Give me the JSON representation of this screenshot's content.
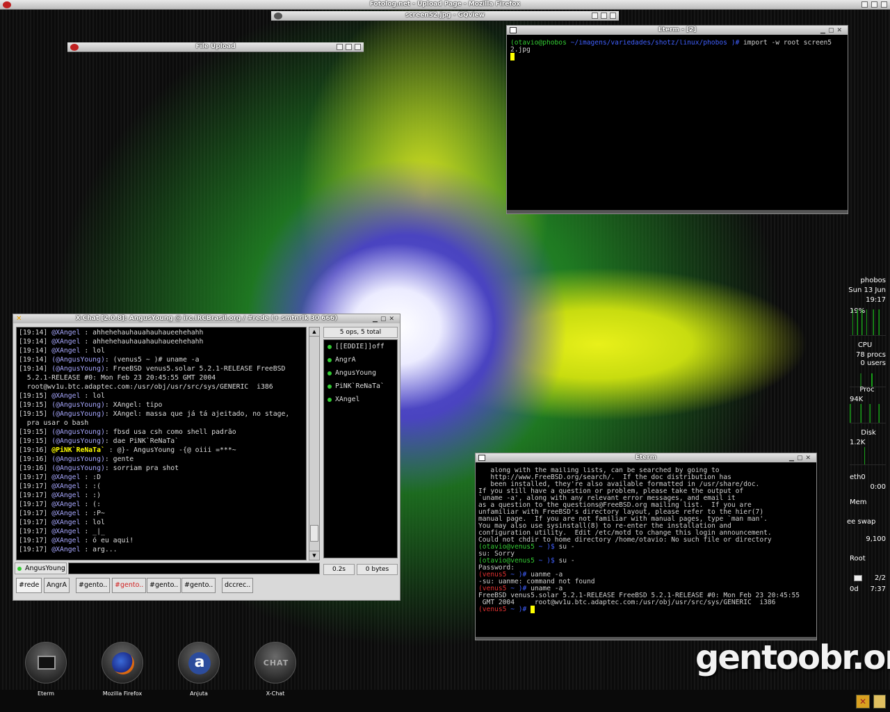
{
  "topbar": {
    "title": "Fotolog.net - Upload Page - Mozilla Firefox"
  },
  "gqview": {
    "title": "screen52.jpg - GQview"
  },
  "file_upload": {
    "title": "File Upload"
  },
  "eterm2": {
    "title": "Eterm - [2]",
    "lines": [
      [
        {
          "t": "(otavio@phobos ",
          "c": "g"
        },
        {
          "t": "~/imagens/variedades/shotz/linux/phobos ",
          "c": "b"
        },
        {
          "t": ")# ",
          "c": "b"
        },
        {
          "t": "import -w root screen5",
          "c": ""
        }
      ],
      [
        {
          "t": "2.jpg",
          "c": ""
        }
      ]
    ]
  },
  "eterm": {
    "title": "Eterm",
    "lines": [
      [
        {
          "t": "   along with the mailing lists, can be searched by going to",
          "c": ""
        }
      ],
      [
        {
          "t": "   http://www.FreeBSD.org/search/.  If the doc distribution has",
          "c": ""
        }
      ],
      [
        {
          "t": "   been installed, they're also available formatted in /usr/share/doc.",
          "c": ""
        }
      ],
      [
        {
          "t": "",
          "c": ""
        }
      ],
      [
        {
          "t": "If you still have a question or problem, please take the output of",
          "c": ""
        }
      ],
      [
        {
          "t": "`uname -a', along with any relevant error messages, and email it",
          "c": ""
        }
      ],
      [
        {
          "t": "as a question to the questions@FreeBSD.org mailing list.  If you are",
          "c": ""
        }
      ],
      [
        {
          "t": "unfamiliar with FreeBSD's directory layout, please refer to the hier(7)",
          "c": ""
        }
      ],
      [
        {
          "t": "manual page.  If you are not familiar with manual pages, type `man man'.",
          "c": ""
        }
      ],
      [
        {
          "t": "",
          "c": ""
        }
      ],
      [
        {
          "t": "You may also use sysinstall(8) to re-enter the installation and",
          "c": ""
        }
      ],
      [
        {
          "t": "configuration utility.  Edit /etc/motd to change this login announcement.",
          "c": ""
        }
      ],
      [
        {
          "t": "",
          "c": ""
        }
      ],
      [
        {
          "t": "Could not chdir to home directory /home/otavio: No such file or directory",
          "c": ""
        }
      ],
      [
        {
          "t": "(otavio@venus5 ",
          "c": "g"
        },
        {
          "t": "~ )$ ",
          "c": "b"
        },
        {
          "t": "su -",
          "c": ""
        }
      ],
      [
        {
          "t": "su: Sorry",
          "c": ""
        }
      ],
      [
        {
          "t": "(otavio@venus5 ",
          "c": "g"
        },
        {
          "t": "~ )$ ",
          "c": "b"
        },
        {
          "t": "su -",
          "c": ""
        }
      ],
      [
        {
          "t": "Password:",
          "c": ""
        }
      ],
      [
        {
          "t": "(venus5 ",
          "c": "r"
        },
        {
          "t": "~ )# ",
          "c": "b"
        },
        {
          "t": "uanme -a",
          "c": ""
        }
      ],
      [
        {
          "t": "-su: uanme: command not found",
          "c": ""
        }
      ],
      [
        {
          "t": "(venus5 ",
          "c": "r"
        },
        {
          "t": "~ )# ",
          "c": "b"
        },
        {
          "t": "uname -a",
          "c": ""
        }
      ],
      [
        {
          "t": "FreeBSD venus5.solar 5.2.1-RELEASE FreeBSD 5.2.1-RELEASE #0: Mon Feb 23 20:45:55",
          "c": ""
        }
      ],
      [
        {
          "t": " GMT 2004     root@wv1u.btc.adaptec.com:/usr/obj/usr/src/sys/GENERIC  i386",
          "c": ""
        }
      ],
      [
        {
          "t": "(venus5 ",
          "c": "r"
        },
        {
          "t": "~ )# ",
          "c": "b"
        }
      ]
    ]
  },
  "xchat": {
    "title": "X-Chat [2.0.8]: AngusYoung @ irc.IRCBrasil.org / #rede (+ smtnrlk 30 666)",
    "ops_label": "5 ops, 5 total",
    "lines": [
      [
        {
          "t": "[19:14] "
        },
        {
          "t": "@XAngel",
          "c": "nick"
        },
        {
          "t": " : ahhehehauhauahauhaueehehahh"
        }
      ],
      [
        {
          "t": "[19:14] "
        },
        {
          "t": "@XAngel",
          "c": "nick"
        },
        {
          "t": " : ahhehehauhauahauhaueehehahh"
        }
      ],
      [
        {
          "t": "[19:14] "
        },
        {
          "t": "@XAngel",
          "c": "nick"
        },
        {
          "t": " : lol"
        }
      ],
      [
        {
          "t": "[19:14] "
        },
        {
          "t": "(@AngusYoung)",
          "c": "nick"
        },
        {
          "t": ": (venus5 ~ )# uname -a"
        }
      ],
      [
        {
          "t": "[19:14] "
        },
        {
          "t": "(@AngusYoung)",
          "c": "nick"
        },
        {
          "t": ": FreeBSD venus5.solar 5.2.1-RELEASE FreeBSD"
        }
      ],
      [
        {
          "t": "  5.2.1-RELEASE #0: Mon Feb 23 20:45:55 GMT 2004"
        }
      ],
      [
        {
          "t": "  root@wv1u.btc.adaptec.com:/usr/obj/usr/src/sys/GENERIC  i386"
        }
      ],
      [
        {
          "t": "[19:15] "
        },
        {
          "t": "@XAngel",
          "c": "nick"
        },
        {
          "t": " : lol"
        }
      ],
      [
        {
          "t": "[19:15] "
        },
        {
          "t": "(@AngusYoung)",
          "c": "nick"
        },
        {
          "t": ": XAngel: tipo"
        }
      ],
      [
        {
          "t": "[19:15] "
        },
        {
          "t": "(@AngusYoung)",
          "c": "nick"
        },
        {
          "t": ": XAngel: massa que já tá ajeitado, no stage,"
        }
      ],
      [
        {
          "t": "  pra usar o bash"
        }
      ],
      [
        {
          "t": "[19:15] "
        },
        {
          "t": "(@AngusYoung)",
          "c": "nick"
        },
        {
          "t": ": fbsd usa csh como shell padrão"
        }
      ],
      [
        {
          "t": "[19:15] "
        },
        {
          "t": "(@AngusYoung)",
          "c": "nick"
        },
        {
          "t": ": dae PiNK`ReNaTa`"
        }
      ],
      [
        {
          "t": "[19:16] "
        },
        {
          "t": "@PiNK`ReNaTa`",
          "c": "pink"
        },
        {
          "t": " : @}- AngusYoung -{@ oiii =***~"
        }
      ],
      [
        {
          "t": "[19:16] "
        },
        {
          "t": "(@AngusYoung)",
          "c": "nick"
        },
        {
          "t": ": gente"
        }
      ],
      [
        {
          "t": "[19:16] "
        },
        {
          "t": "(@AngusYoung)",
          "c": "nick"
        },
        {
          "t": ": sorriam pra shot"
        }
      ],
      [
        {
          "t": "[19:17] "
        },
        {
          "t": "@XAngel",
          "c": "nick"
        },
        {
          "t": " : :D"
        }
      ],
      [
        {
          "t": "[19:17] "
        },
        {
          "t": "@XAngel",
          "c": "nick"
        },
        {
          "t": " : :("
        }
      ],
      [
        {
          "t": "[19:17] "
        },
        {
          "t": "@XAngel",
          "c": "nick"
        },
        {
          "t": " : :)"
        }
      ],
      [
        {
          "t": "[19:17] "
        },
        {
          "t": "@XAngel",
          "c": "nick"
        },
        {
          "t": " : (:"
        }
      ],
      [
        {
          "t": "[19:17] "
        },
        {
          "t": "@XAngel",
          "c": "nick"
        },
        {
          "t": " : :P~"
        }
      ],
      [
        {
          "t": "[19:17] "
        },
        {
          "t": "@XAngel",
          "c": "nick"
        },
        {
          "t": " : lol"
        }
      ],
      [
        {
          "t": "[19:17] "
        },
        {
          "t": "@XAngel",
          "c": "nick"
        },
        {
          "t": " : _|_"
        }
      ],
      [
        {
          "t": "[19:17] "
        },
        {
          "t": "@XAngel",
          "c": "nick"
        },
        {
          "t": " : ó eu aqui!"
        }
      ],
      [
        {
          "t": "[19:17] "
        },
        {
          "t": "@XAngel",
          "c": "nick"
        },
        {
          "t": " : arg..."
        }
      ]
    ],
    "users": [
      "[[EDDIE]]off",
      "AngrA",
      "AngusYoung",
      "PiNK`ReNaTa`",
      "XAngel"
    ],
    "nick": "AngusYoung",
    "lag": "0.2s",
    "throughput": "0 bytes",
    "tabs": [
      {
        "label": "#rede",
        "highlight": false
      },
      {
        "label": "AngrA",
        "highlight": false
      },
      {
        "label": "#gento..",
        "highlight": false
      },
      {
        "label": "#gento..",
        "highlight": true
      },
      {
        "label": "#gento..",
        "highlight": false
      },
      {
        "label": "#gento..",
        "highlight": false
      },
      {
        "label": "dccrec..",
        "highlight": false
      }
    ]
  },
  "dock": {
    "items": [
      {
        "label": "Eterm",
        "icon": "terminal-icon"
      },
      {
        "label": "Mozilla Firefox",
        "icon": "firefox-icon"
      },
      {
        "label": "Anjuta",
        "icon": "anjuta-icon"
      },
      {
        "label": "X-Chat",
        "icon": "chat-icon",
        "glyph": "CHAT"
      }
    ]
  },
  "gkrellm": {
    "host": "phobos",
    "date": "Sun 13 Jun",
    "time": "19:17",
    "cpu_pct": "19%",
    "cpu_label": "CPU",
    "procs": "78 procs",
    "users": "0 users",
    "proc_label": "Proc",
    "proc_val": "94K",
    "disk_label": "Disk",
    "disk_val": "1.2K",
    "net_label": "eth0",
    "net_time": "0:00",
    "mem_label": "Mem",
    "swap_label": "ee swap",
    "swap_val": "9,100",
    "root_label": "Root",
    "mail": "2/2",
    "uptime_d": "0d",
    "uptime_t": "7:37"
  },
  "logo": {
    "text": "gentoobr.org"
  },
  "colors": {
    "prompt_user": "#33cc33",
    "prompt_path": "#4060ff",
    "prompt_root": "#e03030",
    "cursor": "#ffff00"
  }
}
